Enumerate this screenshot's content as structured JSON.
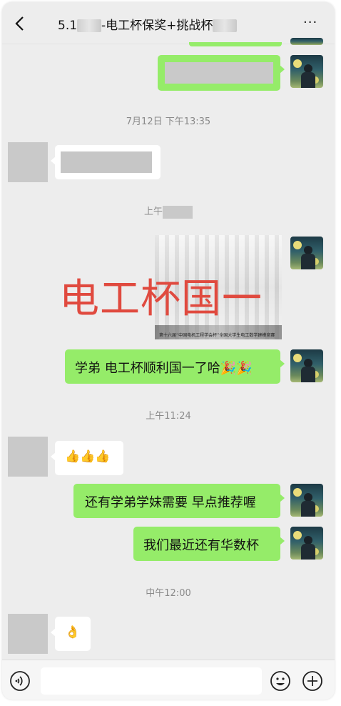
{
  "header": {
    "title_prefix": "5.1",
    "title_main": "-电工杯保奖+挑战杯",
    "more_label": "···"
  },
  "messages": {
    "time1": "7月12日 下午13:35",
    "time2": "上午",
    "overlay_text": "电工杯国一",
    "photo_caption": "第十六届“中国电机工程学会杯”全国大学生电工数学建模竞赛",
    "msg_shunli": "学弟  电工杯顺利国一了哈🎉🎉",
    "time3": "上午11:24",
    "msg_thumbs": "👍👍👍",
    "msg_tuijian": "还有学弟学妹需要  早点推荐喔",
    "msg_huashu": "我们最近还有华数杯",
    "time4": "中午12:00",
    "msg_ok": "👌"
  },
  "colors": {
    "green_bubble": "#95ec69",
    "chat_bg": "#ededed",
    "overlay_red": "#e04a3f"
  },
  "icons": [
    "back-arrow-icon",
    "more-icon",
    "voice-icon",
    "emoji-icon",
    "plus-icon"
  ]
}
